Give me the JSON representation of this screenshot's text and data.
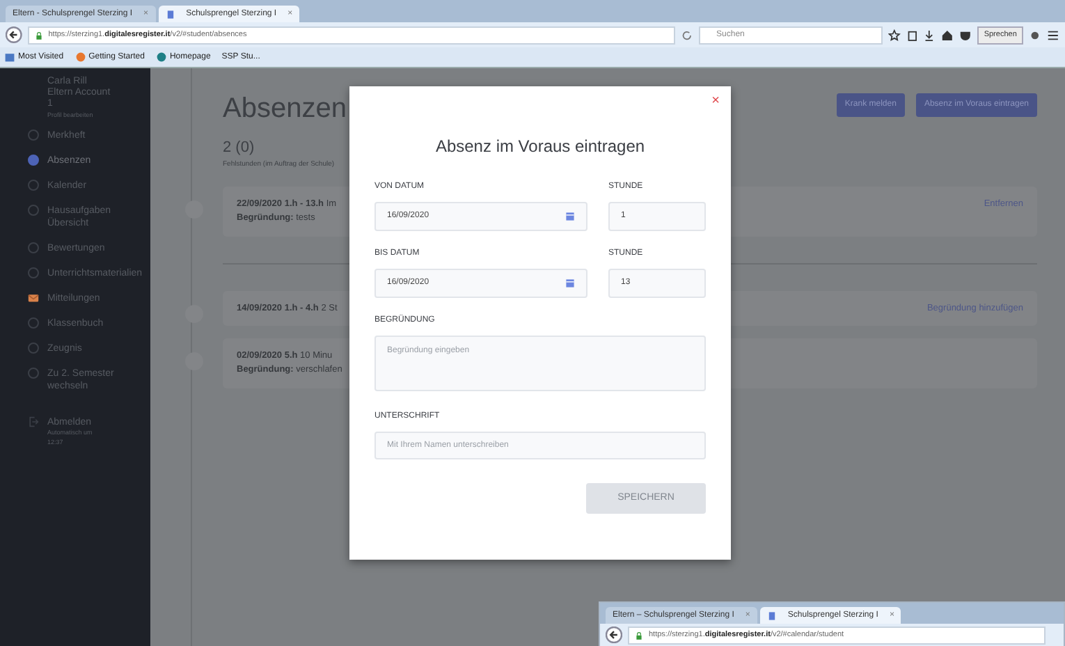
{
  "browser": {
    "tabs": [
      {
        "title": "Eltern - Schulsprengel Sterzing I",
        "close": "×",
        "selected": false
      },
      {
        "title": "Schulsprengel Sterzing I",
        "close": "×",
        "selected": true
      }
    ],
    "url": "https://sterzing1.**digitalesregister.it**/v2/#student/absences",
    "search": {
      "placeholder": "Suchen"
    },
    "speak_button": "Sprechen",
    "bookmarks": [
      {
        "label": "Most Visited",
        "kind": "folder"
      },
      {
        "label": "Getting Started",
        "kind": "globe"
      },
      {
        "label": "Homepage",
        "kind": "leaf"
      },
      {
        "label": "SSP Stu...",
        "kind": "plain"
      }
    ]
  },
  "sidebar": {
    "user": {
      "name": "Carla Rill",
      "role": "Eltern Account",
      "number": "1",
      "edit": "Profil bearbeiten"
    },
    "items": [
      {
        "label": "Merkheft",
        "kind": "circle",
        "selected": false
      },
      {
        "label": "Absenzen",
        "kind": "circle",
        "selected": true
      },
      {
        "label": "Kalender",
        "kind": "circle",
        "selected": false
      },
      {
        "label": "Hausaufgaben Übersicht",
        "kind": "circle",
        "selected": false
      },
      {
        "label": "Bewertungen",
        "kind": "circle",
        "selected": false
      },
      {
        "label": "Unterrichtsmaterialien",
        "kind": "circle",
        "selected": false
      },
      {
        "label": "Mitteilungen",
        "kind": "envelope",
        "selected": false
      },
      {
        "label": "Klassenbuch",
        "kind": "circle",
        "selected": false
      },
      {
        "label": "Zeugnis",
        "kind": "circle",
        "selected": false
      },
      {
        "label": "Zu 2. Semester wechseln",
        "kind": "circle",
        "selected": false
      }
    ],
    "logout": {
      "label": "Abmelden",
      "note": "Automatisch um",
      "time": "12:37"
    }
  },
  "page": {
    "title": "Absenzen",
    "count": "2 (0)",
    "count_note": "Fehlstunden (im Auftrag der Schule)",
    "actions": [
      "Krank melden",
      "Absenz im Voraus eintragen"
    ],
    "groups": [
      [
        {
          "heading": "**22/09/2020 1.h - 13.h** Im",
          "reason": "**Begründung:** tests",
          "action": "Entfernen"
        }
      ],
      [
        {
          "heading": "**14/09/2020 1.h - 4.h** 2 St",
          "action": "Begründung hinzufügen"
        },
        {
          "heading": "**02/09/2020 5.h** 10 Minu",
          "reason": "**Begründung:** verschlafen"
        }
      ]
    ]
  },
  "modal": {
    "close": "×",
    "title": "Absenz im Voraus eintragen",
    "rows": [
      {
        "date": {
          "label": "VON DATUM",
          "value": "16/09/2020"
        },
        "hour": {
          "label": "STUNDE",
          "value": "1"
        }
      },
      {
        "date": {
          "label": "BIS DATUM",
          "value": "16/09/2020"
        },
        "hour": {
          "label": "STUNDE",
          "value": "13"
        }
      }
    ],
    "reason": {
      "label": "BEGRÜNDUNG",
      "placeholder": "Begründung eingeben"
    },
    "signature": {
      "label": "UNTERSCHRIFT",
      "placeholder": "Mit Ihrem Namen unterschreiben"
    },
    "submit": {
      "label": "SPEICHERN",
      "disabled": true
    }
  },
  "second_window": {
    "tabs": [
      {
        "title": "Eltern – Schulsprengel Sterzing I",
        "close": "×",
        "selected": false
      },
      {
        "title": "Schulsprengel Sterzing I",
        "close": "×",
        "selected": true
      }
    ],
    "url": "https://sterzing1.**digitalesregister.it**/v2/#calendar/student"
  }
}
